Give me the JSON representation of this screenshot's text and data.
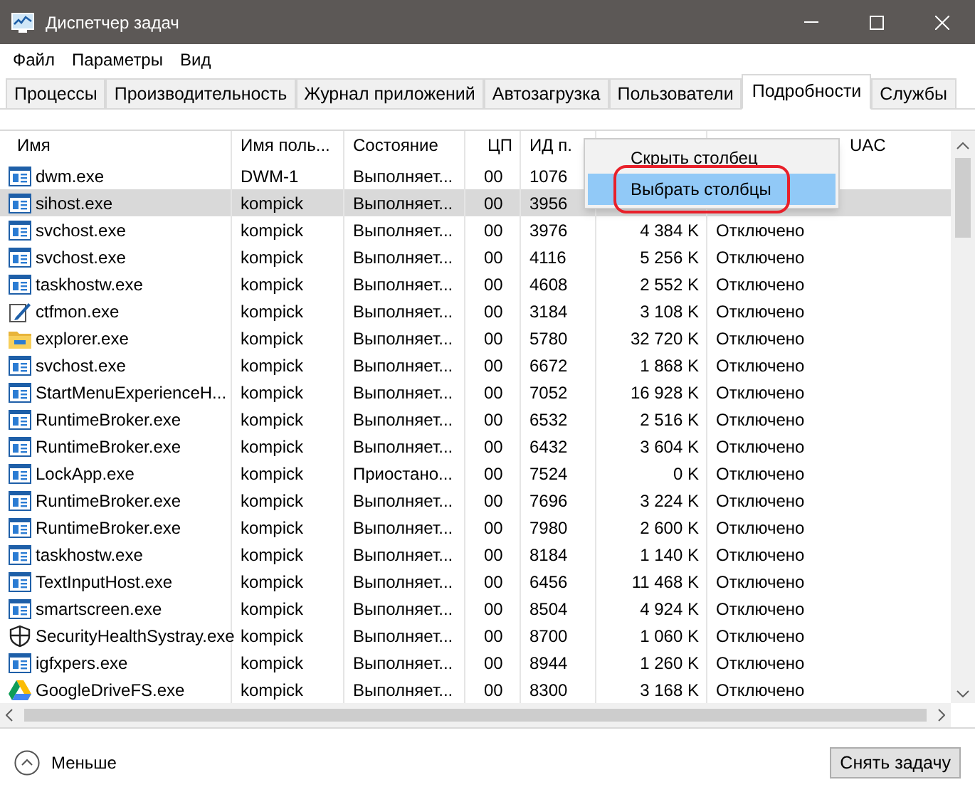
{
  "window": {
    "title": "Диспетчер задач"
  },
  "menu": [
    "Файл",
    "Параметры",
    "Вид"
  ],
  "tabs": [
    {
      "label": "Процессы",
      "selected": false
    },
    {
      "label": "Производительность",
      "selected": false
    },
    {
      "label": "Журнал приложений",
      "selected": false
    },
    {
      "label": "Автозагрузка",
      "selected": false
    },
    {
      "label": "Пользователи",
      "selected": false
    },
    {
      "label": "Подробности",
      "selected": true
    },
    {
      "label": "Службы",
      "selected": false
    }
  ],
  "table": {
    "columns": [
      "Имя",
      "Имя поль...",
      "Состояние",
      "ЦП",
      "ИД п.",
      "UAC"
    ],
    "rows": [
      {
        "kind": "app",
        "name": "dwm.exe",
        "user": "DWM-1",
        "state": "Выполняет...",
        "cpu": "00",
        "pid": "1076",
        "selected": false
      },
      {
        "kind": "app",
        "name": "sihost.exe",
        "user": "kompick",
        "state": "Выполняет...",
        "cpu": "00",
        "pid": "3956",
        "selected": true
      },
      {
        "kind": "app",
        "name": "svchost.exe",
        "user": "kompick",
        "state": "Выполняет...",
        "cpu": "00",
        "pid": "3976",
        "memory": "4 384 K",
        "uac": "Отключено",
        "selected": false
      },
      {
        "kind": "app",
        "name": "svchost.exe",
        "user": "kompick",
        "state": "Выполняет...",
        "cpu": "00",
        "pid": "4116",
        "memory": "5 256 K",
        "uac": "Отключено",
        "selected": false
      },
      {
        "kind": "app",
        "name": "taskhostw.exe",
        "user": "kompick",
        "state": "Выполняет...",
        "cpu": "00",
        "pid": "4608",
        "memory": "2 552 K",
        "uac": "Отключено",
        "selected": false
      },
      {
        "kind": "pen",
        "name": "ctfmon.exe",
        "user": "kompick",
        "state": "Выполняет...",
        "cpu": "00",
        "pid": "3184",
        "memory": "3 108 K",
        "uac": "Отключено",
        "selected": false
      },
      {
        "kind": "folder",
        "name": "explorer.exe",
        "user": "kompick",
        "state": "Выполняет...",
        "cpu": "00",
        "pid": "5780",
        "memory": "32 720 K",
        "uac": "Отключено",
        "selected": false
      },
      {
        "kind": "app",
        "name": "svchost.exe",
        "user": "kompick",
        "state": "Выполняет...",
        "cpu": "00",
        "pid": "6672",
        "memory": "1 868 K",
        "uac": "Отключено",
        "selected": false
      },
      {
        "kind": "app",
        "name": "StartMenuExperienceH...",
        "user": "kompick",
        "state": "Выполняет...",
        "cpu": "00",
        "pid": "7052",
        "memory": "16 928 K",
        "uac": "Отключено",
        "selected": false
      },
      {
        "kind": "app",
        "name": "RuntimeBroker.exe",
        "user": "kompick",
        "state": "Выполняет...",
        "cpu": "00",
        "pid": "6532",
        "memory": "2 516 K",
        "uac": "Отключено",
        "selected": false
      },
      {
        "kind": "app",
        "name": "RuntimeBroker.exe",
        "user": "kompick",
        "state": "Выполняет...",
        "cpu": "00",
        "pid": "6432",
        "memory": "3 604 K",
        "uac": "Отключено",
        "selected": false
      },
      {
        "kind": "app",
        "name": "LockApp.exe",
        "user": "kompick",
        "state": "Приостано...",
        "cpu": "00",
        "pid": "7524",
        "memory": "0 K",
        "uac": "Отключено",
        "selected": false
      },
      {
        "kind": "app",
        "name": "RuntimeBroker.exe",
        "user": "kompick",
        "state": "Выполняет...",
        "cpu": "00",
        "pid": "7696",
        "memory": "3 224 K",
        "uac": "Отключено",
        "selected": false
      },
      {
        "kind": "app",
        "name": "RuntimeBroker.exe",
        "user": "kompick",
        "state": "Выполняет...",
        "cpu": "00",
        "pid": "7980",
        "memory": "2 600 K",
        "uac": "Отключено",
        "selected": false
      },
      {
        "kind": "app",
        "name": "taskhostw.exe",
        "user": "kompick",
        "state": "Выполняет...",
        "cpu": "00",
        "pid": "8184",
        "memory": "1 140 K",
        "uac": "Отключено",
        "selected": false
      },
      {
        "kind": "app",
        "name": "TextInputHost.exe",
        "user": "kompick",
        "state": "Выполняет...",
        "cpu": "00",
        "pid": "6456",
        "memory": "11 468 K",
        "uac": "Отключено",
        "selected": false
      },
      {
        "kind": "app",
        "name": "smartscreen.exe",
        "user": "kompick",
        "state": "Выполняет...",
        "cpu": "00",
        "pid": "8504",
        "memory": "4 924 K",
        "uac": "Отключено",
        "selected": false
      },
      {
        "kind": "shield",
        "name": "SecurityHealthSystray.exe",
        "user": "kompick",
        "state": "Выполняет...",
        "cpu": "00",
        "pid": "8700",
        "memory": "1 060 K",
        "uac": "Отключено",
        "selected": false
      },
      {
        "kind": "app",
        "name": "igfxpers.exe",
        "user": "kompick",
        "state": "Выполняет...",
        "cpu": "00",
        "pid": "8944",
        "memory": "1 260 K",
        "uac": "Отключено",
        "selected": false
      },
      {
        "kind": "drive",
        "name": "GoogleDriveFS.exe",
        "user": "kompick",
        "state": "Выполняет...",
        "cpu": "00",
        "pid": "8300",
        "memory": "3 168 K",
        "uac": "Отключено",
        "selected": false
      }
    ]
  },
  "context_menu": {
    "items": [
      {
        "label": "Скрыть столбец",
        "selected": false
      },
      {
        "label": "Выбрать столбцы",
        "selected": true
      }
    ]
  },
  "footer": {
    "toggle": "Меньше",
    "button": "Снять задачу"
  }
}
